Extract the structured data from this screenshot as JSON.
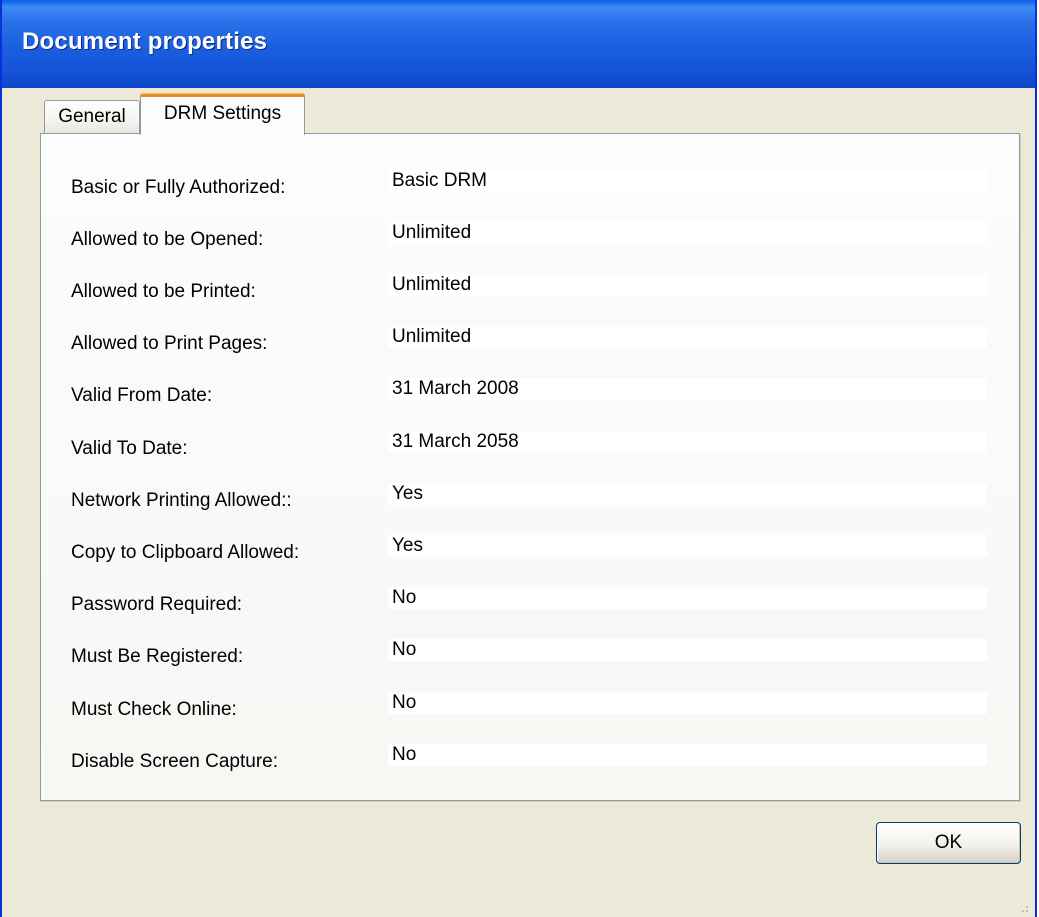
{
  "window": {
    "title": "Document properties"
  },
  "tabs": [
    {
      "label": "General",
      "active": false
    },
    {
      "label": "DRM Settings",
      "active": true
    }
  ],
  "drm_settings": [
    {
      "label": "Basic or Fully Authorized:",
      "value": "Basic DRM"
    },
    {
      "label": "Allowed to be Opened:",
      "value": "Unlimited"
    },
    {
      "label": "Allowed to be Printed:",
      "value": "Unlimited"
    },
    {
      "label": "Allowed to Print Pages:",
      "value": "Unlimited"
    },
    {
      "label": "Valid From Date:",
      "value": "31 March 2008"
    },
    {
      "label": "Valid To Date:",
      "value": "31 March 2058"
    },
    {
      "label": "Network Printing Allowed::",
      "value": "Yes"
    },
    {
      "label": "Copy to Clipboard Allowed:",
      "value": "Yes"
    },
    {
      "label": "Password Required:",
      "value": "No"
    },
    {
      "label": "Must Be Registered:",
      "value": "No"
    },
    {
      "label": "Must Check Online:",
      "value": "No"
    },
    {
      "label": "Disable Screen Capture:",
      "value": "No"
    }
  ],
  "buttons": {
    "ok_label": "OK"
  },
  "colors": {
    "titlebar": "#1a5fe0",
    "window_bg": "#ece9d8",
    "active_tab_accent": "#e68b2c",
    "panel_border": "#919b9c"
  }
}
